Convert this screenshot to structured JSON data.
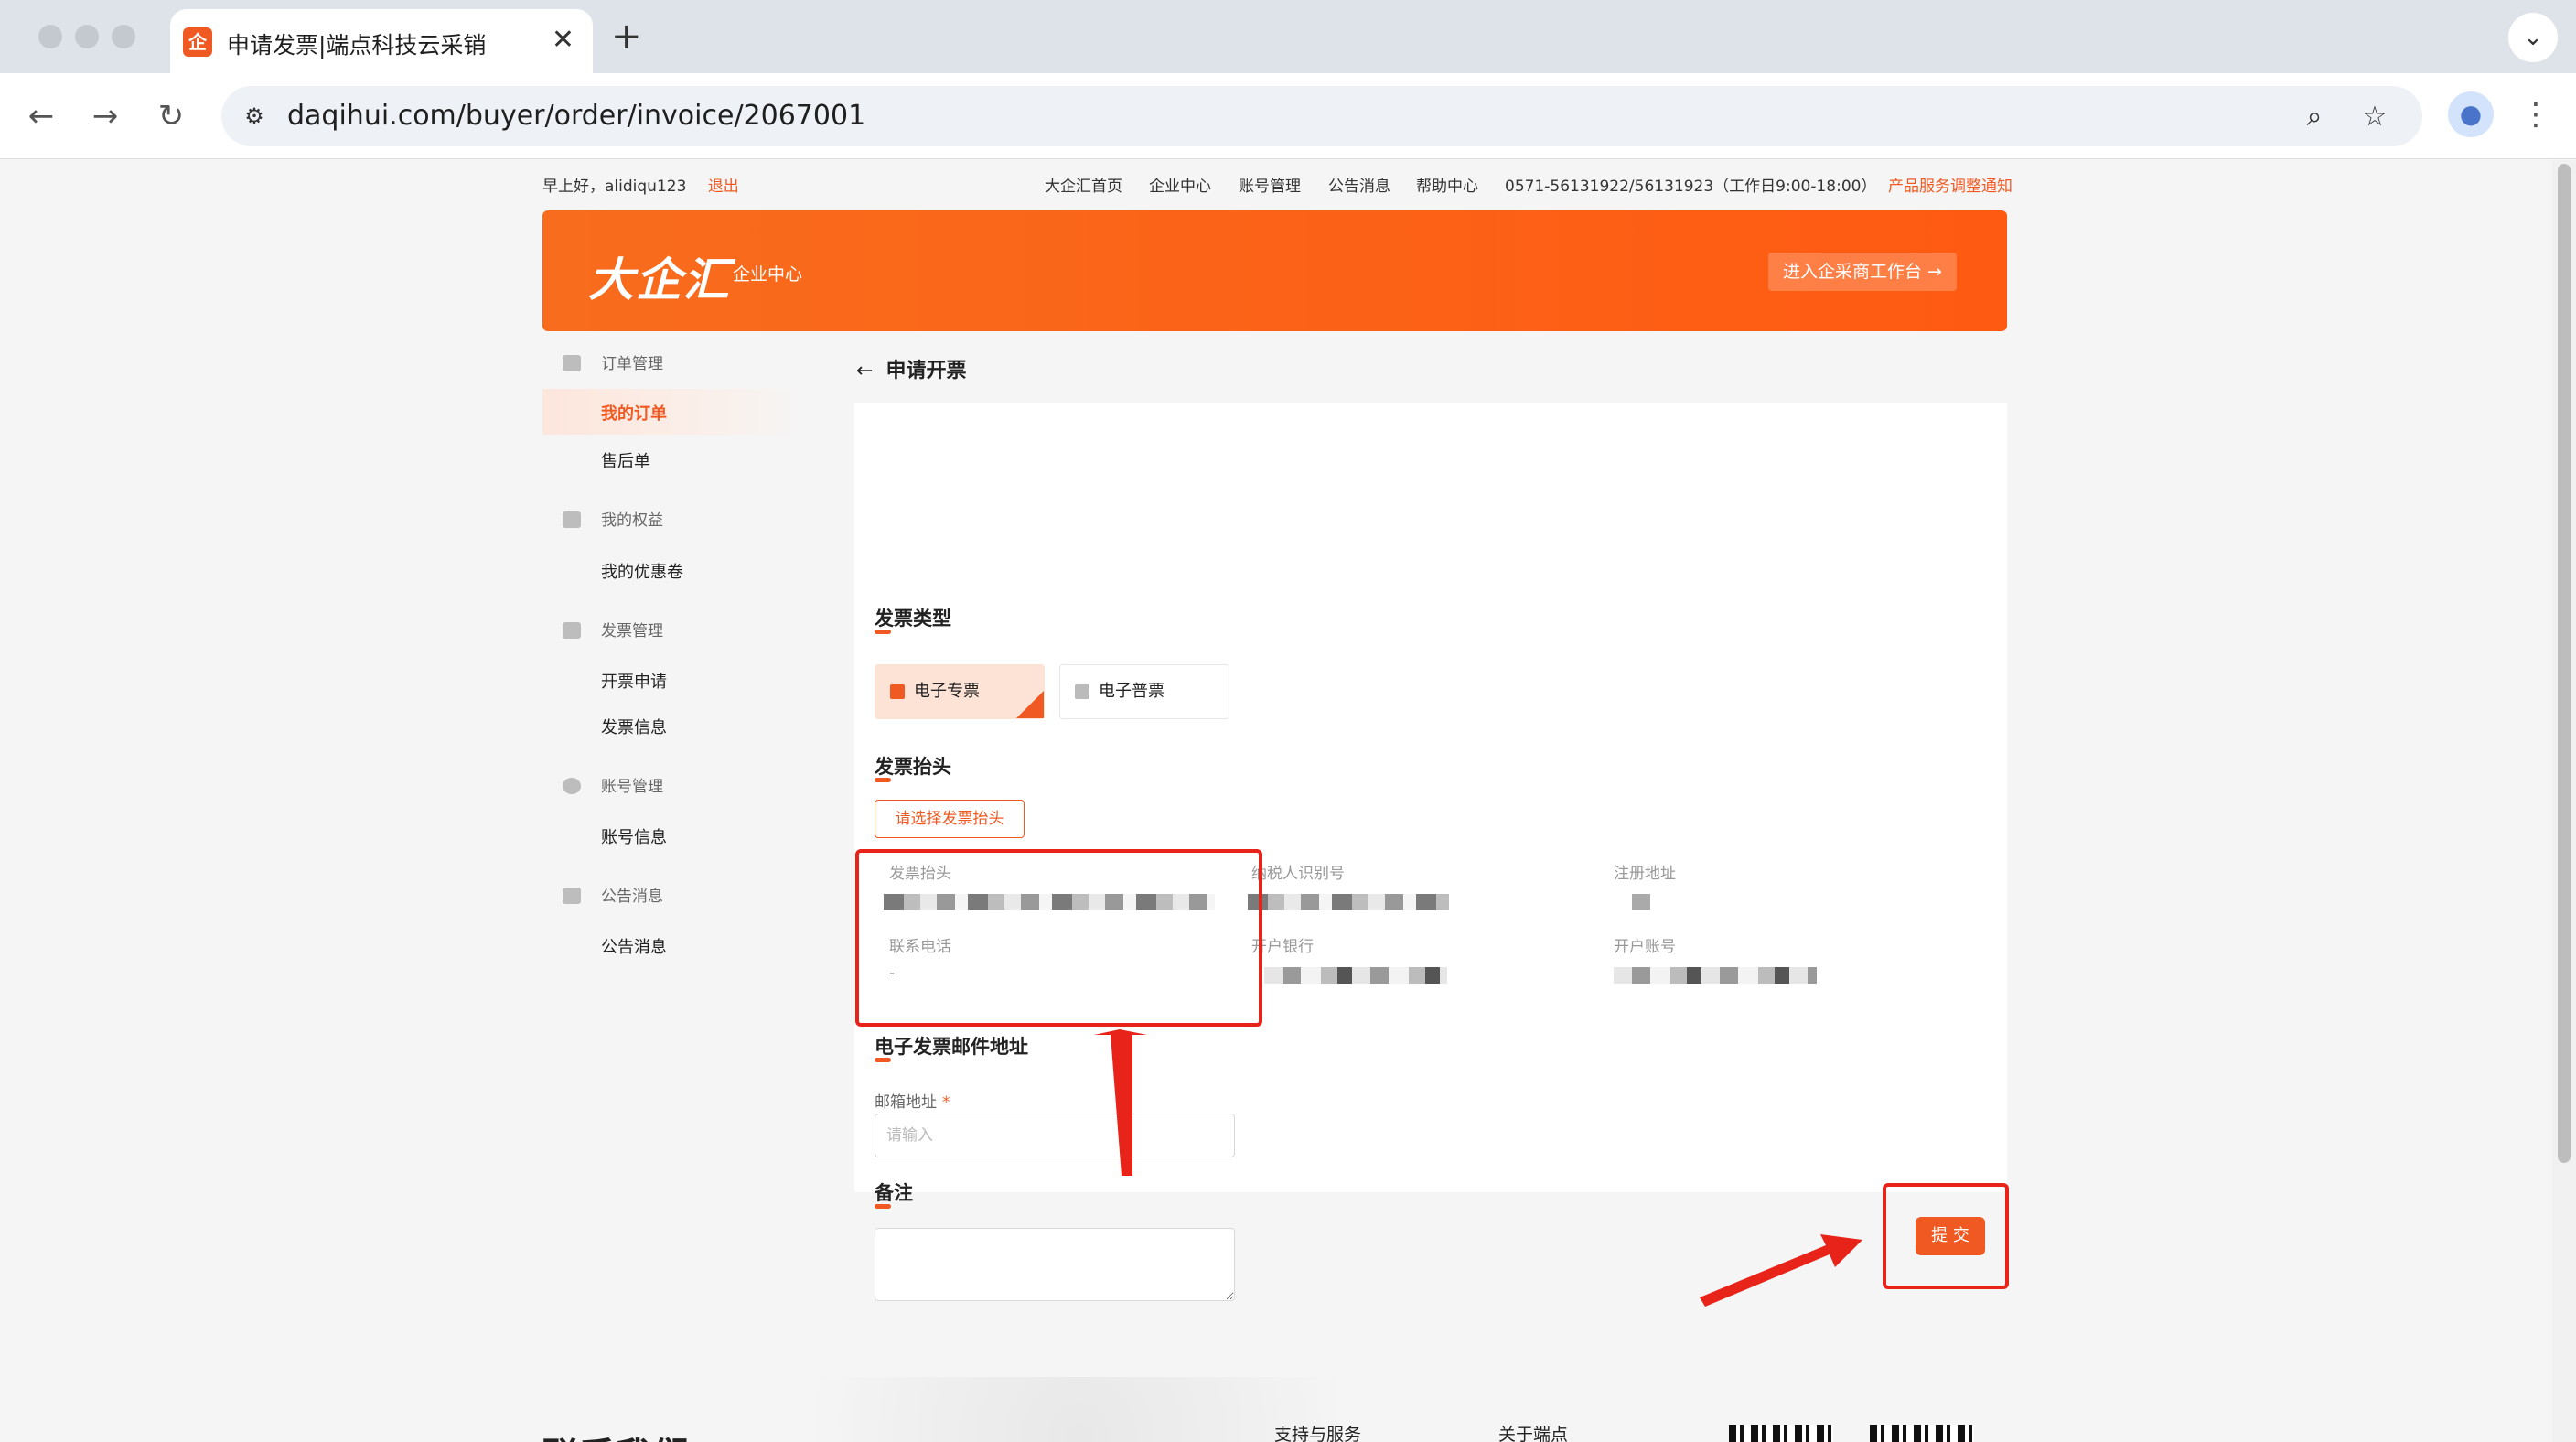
{
  "browser": {
    "tab_title": "申请发票|端点科技云采销",
    "tab_favicon": "企",
    "url": "daqihui.com/buyer/order/invoice/2067001"
  },
  "topbar": {
    "greeting": "早上好，alidiqu123",
    "logout": "退出",
    "links": [
      "大企汇首页",
      "企业中心",
      "账号管理",
      "公告消息",
      "帮助中心"
    ],
    "phone": "0571-56131922/56131923（工作日9:00-18:00）",
    "notice": "产品服务调整通知"
  },
  "banner": {
    "logo": "大企汇",
    "subtitle": "企业中心",
    "enter_button": "进入企采商工作台 →"
  },
  "sidebar": {
    "groups": [
      {
        "label": "订单管理",
        "items": [
          "我的订单",
          "售后单"
        ]
      },
      {
        "label": "我的权益",
        "items": [
          "我的优惠卷"
        ]
      },
      {
        "label": "发票管理",
        "items": [
          "开票申请",
          "发票信息"
        ]
      },
      {
        "label": "账号管理",
        "items": [
          "账号信息"
        ]
      },
      {
        "label": "公告消息",
        "items": [
          "公告消息"
        ]
      }
    ],
    "active_item": "我的订单"
  },
  "content": {
    "back_arrow": "←",
    "page_title": "申请开票",
    "invoice_type_title": "发票类型",
    "invoice_types": [
      "电子专票",
      "电子普票"
    ],
    "selected_type": "电子专票",
    "header_title": "发票抬头",
    "select_header_button": "请选择发票抬头",
    "info": {
      "labels": [
        "发票抬头",
        "纳税人识别号",
        "注册地址",
        "联系电话",
        "开户银行",
        "开户账号"
      ],
      "phone_value": "-"
    },
    "email_section_title": "电子发票邮件地址",
    "email_label": "邮箱地址",
    "required_mark": "*",
    "email_placeholder": "请输入",
    "remark_title": "备注",
    "submit": "提 交"
  },
  "footer": {
    "big_title": "联系我们",
    "columns": [
      "支持与服务",
      "关于端点"
    ]
  },
  "colors": {
    "accent": "#f05a22",
    "annotation": "#e8231a"
  }
}
